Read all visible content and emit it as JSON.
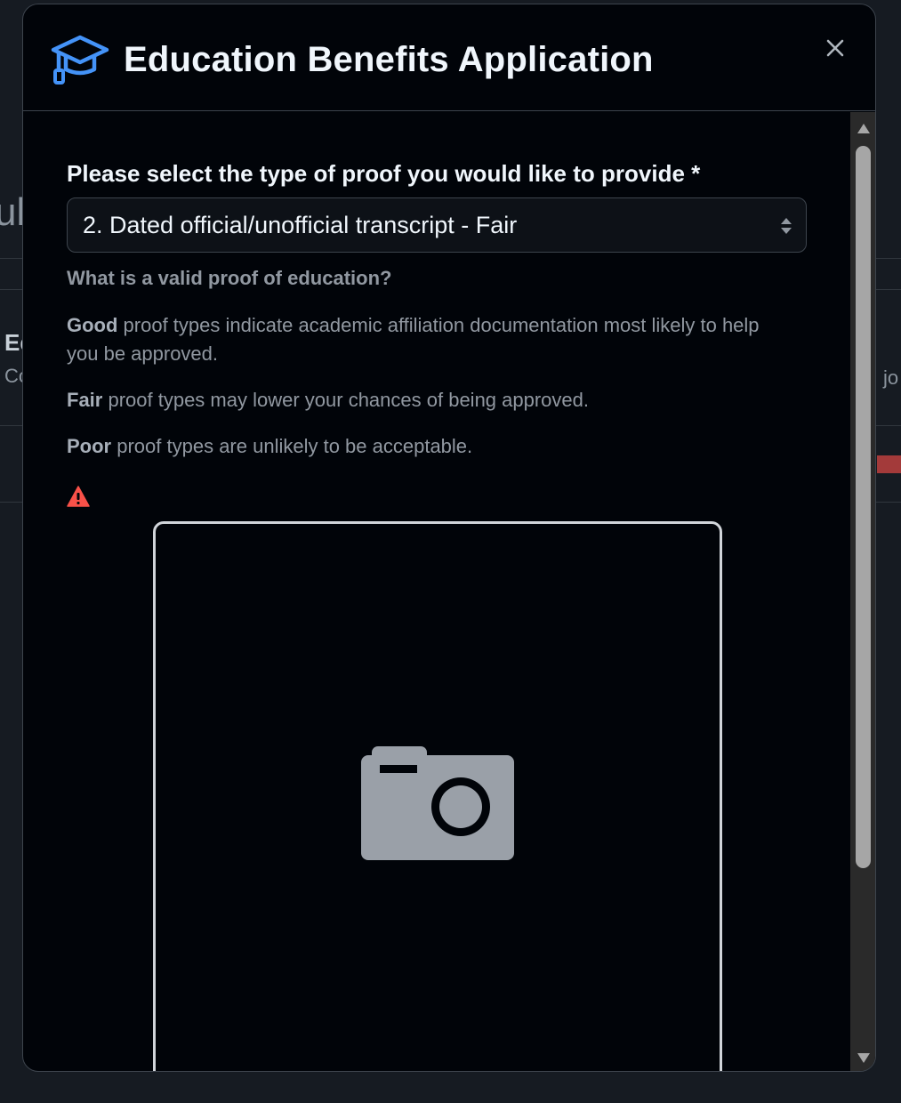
{
  "background": {
    "frag_left_title": "ub",
    "frag_left_heading": "Ed",
    "frag_left_sub": "Co",
    "frag_right": "jo"
  },
  "modal": {
    "title": "Education Benefits Application",
    "icon": "graduation-cap-icon",
    "close_icon": "close-icon"
  },
  "form": {
    "proof_label": "Please select the type of proof you would like to provide *",
    "proof_selected": "2. Dated official/unofficial transcript - Fair",
    "help_heading": "What is a valid proof of education?",
    "good_term": "Good",
    "good_text": " proof types indicate academic affiliation documentation most likely to help you be approved.",
    "fair_term": "Fair",
    "fair_text": " proof types may lower your chances of being approved.",
    "poor_term": "Poor",
    "poor_text": " proof types are unlikely to be acceptable.",
    "warning_icon": "warning-icon",
    "upload_icon": "camera-icon"
  },
  "colors": {
    "accent_icon": "#4493f8",
    "warning": "#f85149",
    "modal_bg": "#010409"
  }
}
